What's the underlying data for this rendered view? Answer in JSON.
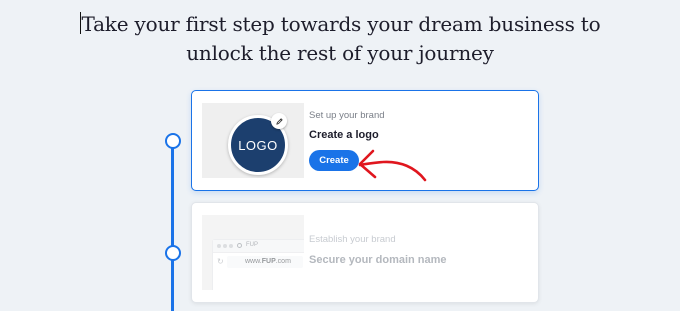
{
  "headline": {
    "line1": "Take your first step towards your dream business to",
    "line2": "unlock the rest of your journey"
  },
  "steps": [
    {
      "eyebrow": "Set up your brand",
      "title": "Create a logo",
      "button_label": "Create",
      "logo_text": "LOGO",
      "active": true
    },
    {
      "eyebrow": "Establish your brand",
      "title": "Secure your domain name",
      "browser_tab_text": "FUP",
      "browser_url_prefix": "www.",
      "browser_url_domain": "FUP",
      "browser_url_suffix": ".com",
      "active": false
    }
  ],
  "colors": {
    "accent": "#1a73e8",
    "logo_bg": "#1c3f6e",
    "arrow": "#e0161e"
  },
  "icons": [
    "pencil-icon",
    "globe-icon",
    "refresh-icon",
    "arrow-annotation"
  ]
}
